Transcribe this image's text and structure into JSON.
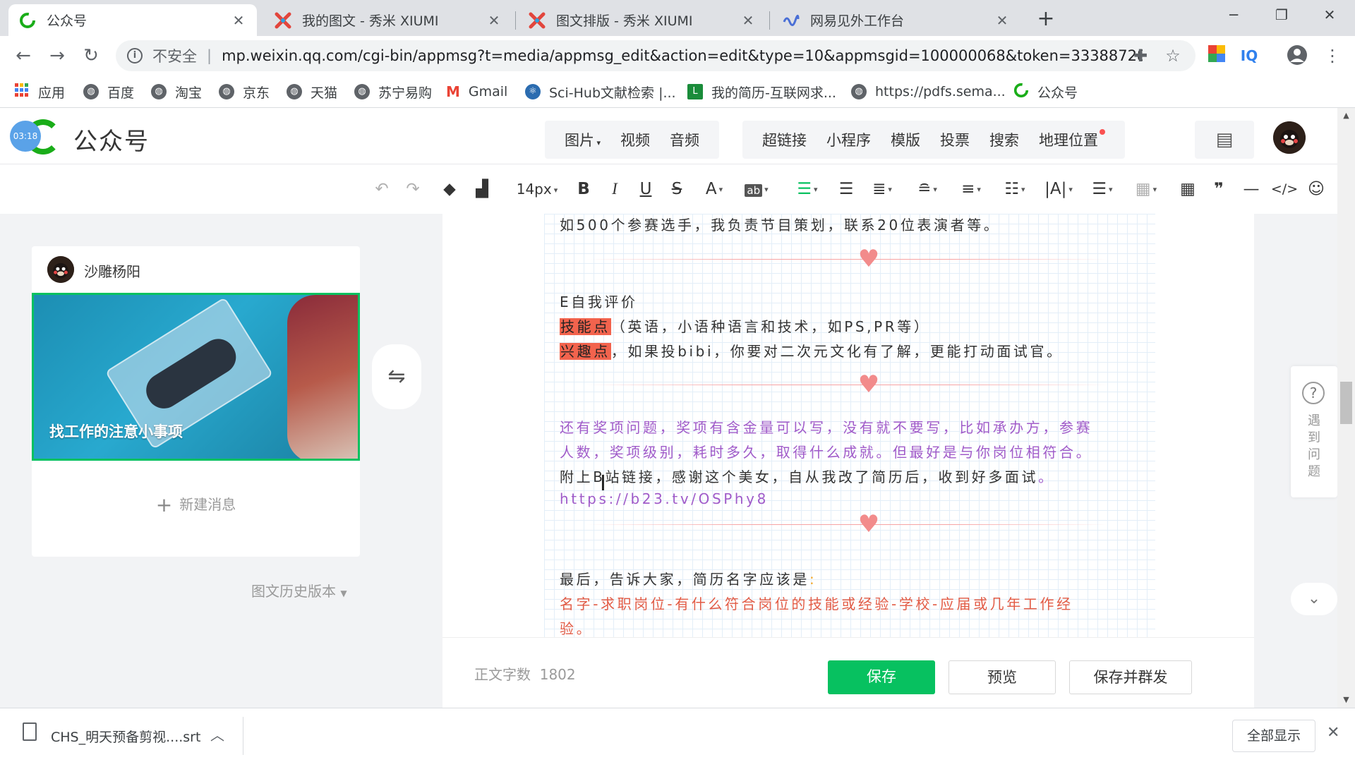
{
  "browser": {
    "tabs": [
      {
        "title": "公众号",
        "icon": "wechat-mp-icon",
        "active": true
      },
      {
        "title": "我的图文 - 秀米 XIUMI",
        "icon": "xiumi-icon",
        "active": false
      },
      {
        "title": "图文排版 - 秀米 XIUMI",
        "icon": "xiumi-icon",
        "active": false
      },
      {
        "title": "网易见外工作台",
        "icon": "netease-icon",
        "active": false
      }
    ],
    "security_label": "不安全",
    "url": "mp.weixin.qq.com/cgi-bin/appmsg?t=media/appmsg_edit&action=edit&type=10&appmsgid=100000068&token=33388728...",
    "bookmarks": [
      "应用",
      "百度",
      "淘宝",
      "京东",
      "天猫",
      "苏宁易购",
      "Gmail",
      "Sci-Hub文献检索 |...",
      "我的简历-互联网求...",
      "https://pdfs.sema...",
      "公众号"
    ],
    "omnibox_ext_label": "IQ"
  },
  "header": {
    "clock": "03:18",
    "brand": "公众号",
    "insert_group1": [
      "图片",
      "视频",
      "音频"
    ],
    "insert_group2": [
      "超链接",
      "小程序",
      "模版",
      "投票",
      "搜索",
      "地理位置"
    ]
  },
  "toolbar": {
    "font_size": "14px",
    "items": [
      "undo",
      "redo",
      "format-brush",
      "clear-format",
      "bold",
      "italic",
      "underline",
      "strikethrough",
      "font-color",
      "bg-color",
      "align",
      "indent",
      "spacing"
    ]
  },
  "left": {
    "author": "沙雕杨阳",
    "cover_title": "找工作的注意小事项",
    "new_message": "新建消息",
    "history": "图文历史版本"
  },
  "content": {
    "line1": "如500个参赛选手，我负责节目策划，联系20位表演者等。",
    "self_eval": "E自我评价",
    "skill_tag": "技能点",
    "skill_text": "（英语，小语种语言和技术，如PS,PR等）",
    "interest_tag": "兴趣点",
    "interest_text": "，如果投bibi，你要对二次元文化有了解，更能打动面试官。",
    "award1": "还有奖项问题，奖项有含金量可以写，没有就不要写，比如承办方，参赛",
    "award2": "人数，奖项级别，耗时多久，取得什么成就。但最好是与你岗位相符合。",
    "bili_pre": "附上B站链接，感谢这个美女，自从我改了简历后，收到好多面试",
    "bili_end": "。",
    "link": "https://b23.tv/OSPhy8",
    "final": "最后，告诉大家，简历名字应该是",
    "final_colon": ":",
    "name_format1": "名字-求职岗位-有什么符合岗位的技能或经验-学校-应届或几年工作经",
    "name_format2": "验。"
  },
  "footer": {
    "word_count_label": "正文字数",
    "word_count": "1802",
    "save": "保存",
    "preview": "预览",
    "save_publish": "保存并群发"
  },
  "help": {
    "text": "遇到问题"
  },
  "download": {
    "file": "CHS_明天预备剪视....srt",
    "show_all": "全部显示"
  },
  "colors": {
    "accent": "#07c160",
    "highlight": "#f2634d",
    "purple_text": "#a05bc9",
    "orange_text": "#e25b45"
  }
}
